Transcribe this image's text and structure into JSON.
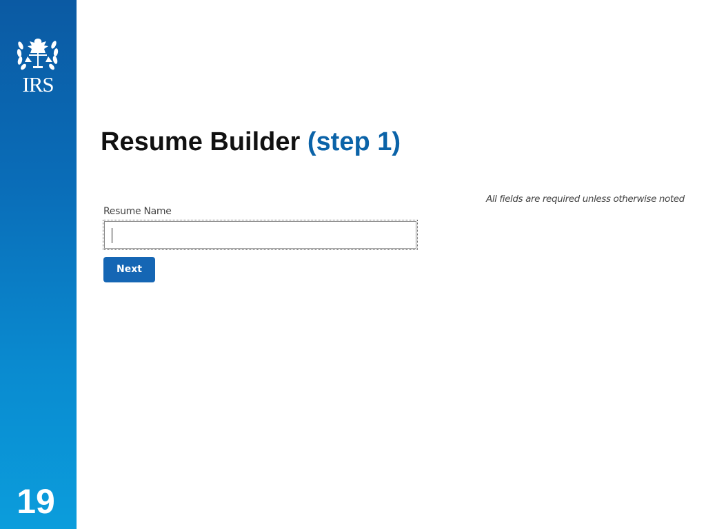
{
  "sidebar": {
    "logo_text": "IRS",
    "logo_icon": "irs-eagle-emblem-icon",
    "page_number": "19",
    "colors": {
      "band_top": "#0b5aa3",
      "band_bottom": "#0b9ddc"
    }
  },
  "title": {
    "main": "Resume Builder",
    "step": "(step 1)",
    "step_color": "#0b63a8"
  },
  "form": {
    "required_note": "All fields are required unless otherwise noted",
    "resume_name_label": "Resume Name",
    "resume_name_value": "",
    "next_label": "Next",
    "next_color": "#1566b4"
  }
}
